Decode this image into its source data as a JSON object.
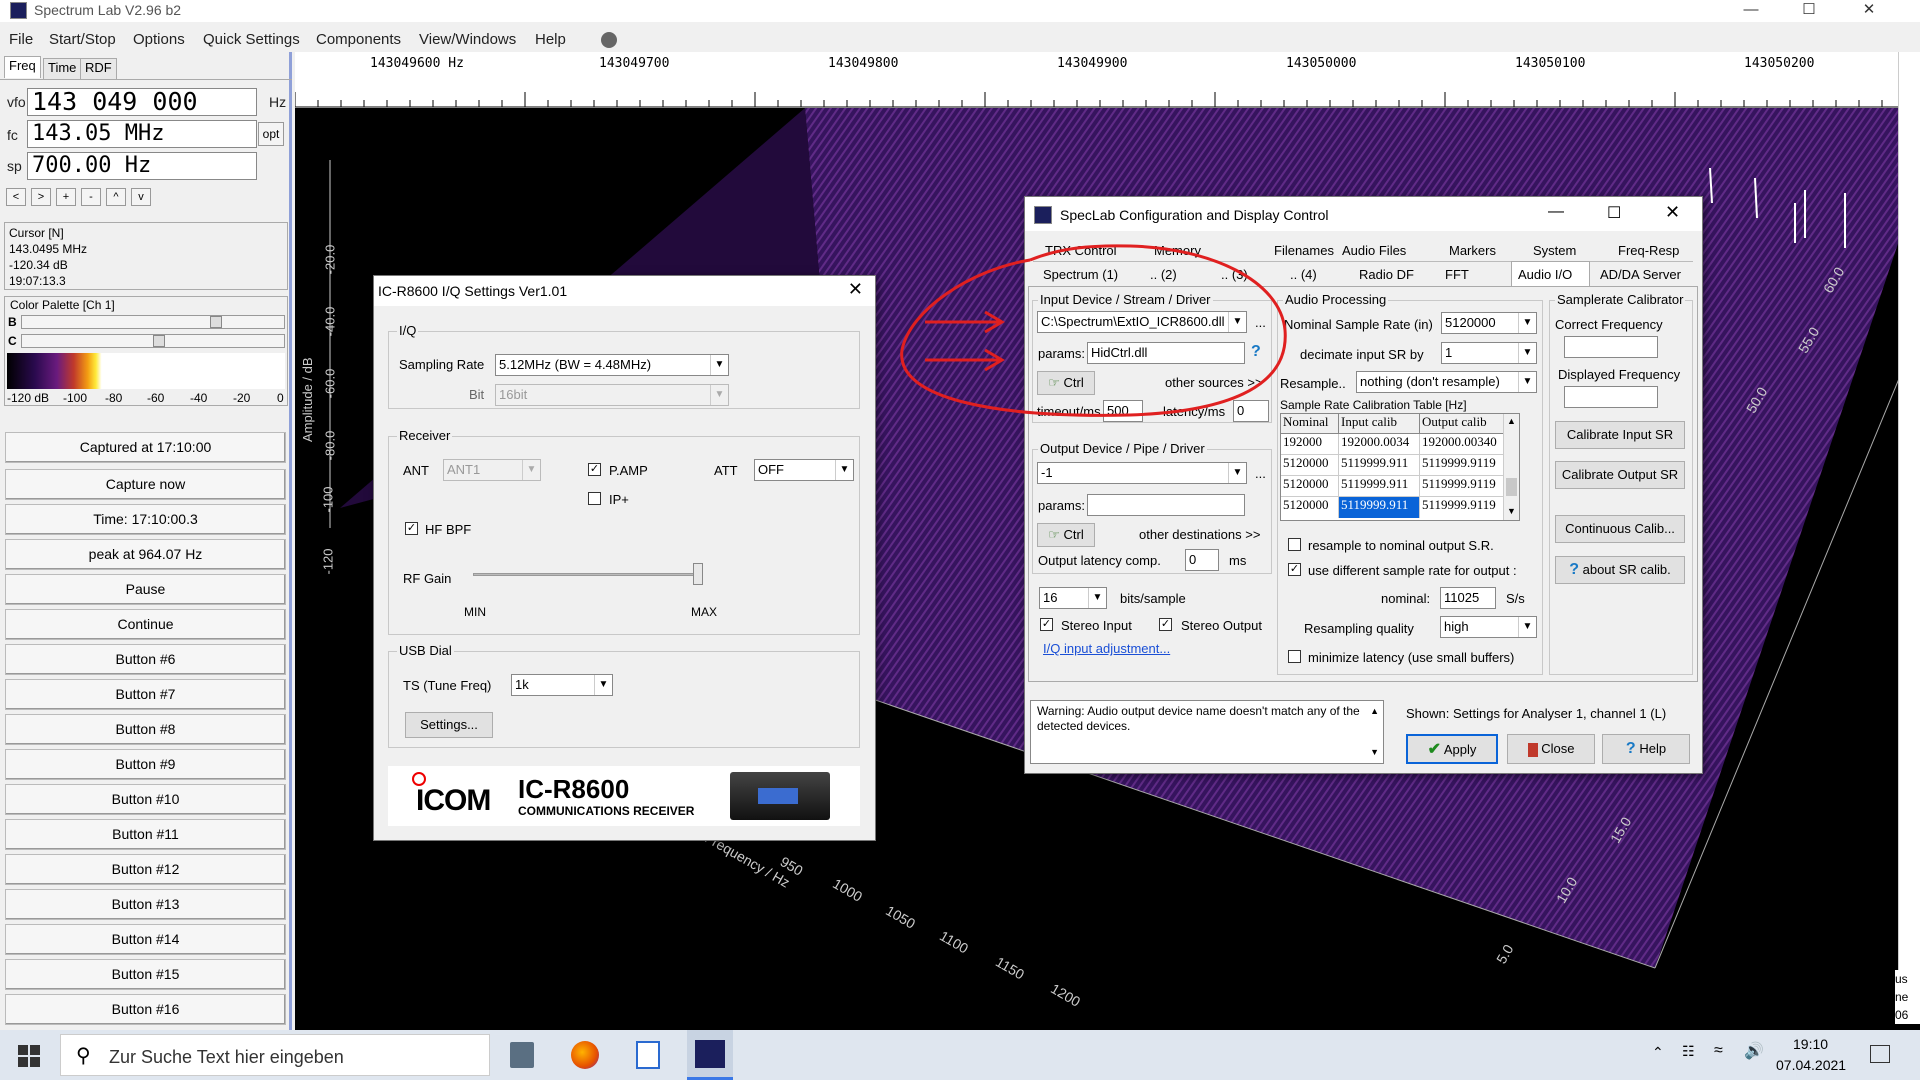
{
  "app": {
    "title": "Spectrum Lab V2.96 b2"
  },
  "menu": [
    "File",
    "Start/Stop",
    "Options",
    "Quick Settings",
    "Components",
    "View/Windows",
    "Help"
  ],
  "left": {
    "tabs": [
      "Freq",
      "Time",
      "RDF"
    ],
    "vfo_label": "vfo",
    "vfo_value": "143 049 000",
    "vfo_unit": "Hz",
    "fc_label": "fc",
    "fc_value": "143.05 MHz",
    "fc_opt": "opt",
    "sp_label": "sp",
    "sp_value": "700.00 Hz",
    "nav_buttons": [
      "<",
      ">",
      "+",
      "-",
      "^",
      "v"
    ],
    "cursor_title": "Cursor [N]",
    "cursor_lines": [
      "143.0495 MHz",
      "-120.34 dB",
      "19:07:13.3"
    ],
    "palette_title": "Color Palette [Ch 1]",
    "palette_b": "B",
    "palette_c": "C",
    "palette_ticks": [
      "-120 dB",
      "-100",
      "-80",
      "-60",
      "-40",
      "-20",
      "0"
    ],
    "buttons": [
      "Captured at 17:10:00",
      "Capture now",
      "Time:  17:10:00.3",
      "peak at 964.07 Hz",
      "Pause",
      "Continue",
      "Button #6",
      "Button #7",
      "Button #8",
      "Button #9",
      "Button #10",
      "Button #11",
      "Button #12",
      "Button #13",
      "Button #14",
      "Button #15",
      "Button #16"
    ]
  },
  "spectrum": {
    "freq_ticks": [
      "143049600 Hz",
      "143049700",
      "143049800",
      "143049900",
      "143050000",
      "143050100",
      "143050200"
    ],
    "amp_label": "Amplitude / dB",
    "amp_ticks": [
      "-20.0",
      "-40.0",
      "-60.0",
      "-80.0",
      "-100",
      "-120"
    ],
    "freq_axis_label": "Frequency / Hz",
    "freq_axis_ticks": [
      "950",
      "1000",
      "1050",
      "1100",
      "1150",
      "1200"
    ],
    "time_ticks": [
      "60.0",
      "55.0",
      "50.0",
      "15.0",
      "10.0",
      "5.0"
    ],
    "edge_text": [
      "us",
      "ne",
      "06"
    ]
  },
  "icr": {
    "title": "IC-R8600 I/Q Settings    Ver1.01",
    "iq_group": "I/Q",
    "sampling_rate_label": "Sampling Rate",
    "sampling_rate_value": "5.12MHz (BW = 4.48MHz)",
    "bit_label": "Bit",
    "bit_value": "16bit",
    "receiver_group": "Receiver",
    "ant_label": "ANT",
    "ant_value": "ANT1",
    "pamp_label": "P.AMP",
    "ipplus_label": "IP+",
    "att_label": "ATT",
    "att_value": "OFF",
    "hfbpf_label": "HF BPF",
    "rfgain_label": "RF Gain",
    "rfgain_min": "MIN",
    "rfgain_max": "MAX",
    "rfgain_level": 1.0,
    "usb_group": "USB Dial",
    "ts_label": "TS (Tune Freq)",
    "ts_value": "1k",
    "settings_button": "Settings...",
    "logo_brand": "ICOM",
    "logo_model": "IC-R8600",
    "logo_sub": "COMMUNICATIONS RECEIVER"
  },
  "speclab": {
    "title": "SpecLab   Configuration and Display Control",
    "tabs_row1": [
      "TRX Control",
      "Memory",
      "Filenames",
      "Audio Files",
      "Markers",
      "System",
      "Freq-Resp"
    ],
    "tabs_row2": [
      "Spectrum (1)",
      ".. (2)",
      ".. (3)",
      ".. (4)",
      "Radio DF",
      "FFT",
      "Audio I/O",
      "AD/DA Server"
    ],
    "input_group": "Input Device / Stream / Driver",
    "input_device": "C:\\Spectrum\\ExtIO_ICR8600.dll",
    "params_label": "params:",
    "params_value": "HidCtrl.dll",
    "ctrl_label": "Ctrl",
    "other_sources": "other sources >>",
    "timeout_label": "timeout/ms",
    "timeout_value": "500",
    "latency_label": "latency/ms",
    "latency_value": "0",
    "output_group": "Output Device / Pipe / Driver",
    "output_device": "-1",
    "out_params_label": "params:",
    "out_params_value": "",
    "out_ctrl_label": "Ctrl",
    "other_destinations": "other destinations >>",
    "out_latency_label": "Output latency comp.",
    "out_latency_value": "0",
    "out_latency_unit": "ms",
    "bits_value": "16",
    "bits_label": "bits/sample",
    "stereo_in": "Stereo Input",
    "stereo_out": "Stereo Output",
    "iq_link": "I/Q input adjustment...",
    "audio_group": "Audio Processing",
    "nominal_sr_label": "Nominal Sample Rate (in)",
    "nominal_sr_value": "5120000",
    "decimate_label": "decimate input SR by",
    "decimate_value": "1",
    "resample_label": "Resample..",
    "resample_value": "nothing (don't resample)",
    "calib_table_label": "Sample Rate Calibration Table [Hz]",
    "calib_headers": [
      "Nominal",
      "Input calib",
      "Output calib"
    ],
    "calib_rows": [
      [
        "192000",
        "192000.0034",
        "192000.00340"
      ],
      [
        "5120000",
        "5119999.911",
        "5119999.9119"
      ],
      [
        "5120000",
        "5119999.911",
        "5119999.9119"
      ],
      [
        "5120000",
        "5119999.911",
        "5119999.9119"
      ]
    ],
    "resample_nominal_label": "resample to nominal output S.R.",
    "diff_rate_label": "use different sample rate for output :",
    "nominal_label": "nominal:",
    "nominal_value": "11025",
    "nominal_unit": "S/s",
    "quality_label": "Resampling quality",
    "quality_value": "high",
    "minlat_label": "minimize latency (use small buffers)",
    "calibrator_group": "Samplerate Calibrator",
    "correct_freq_label": "Correct Frequency",
    "displayed_freq_label": "Displayed Frequency",
    "calib_input_btn": "Calibrate Input SR",
    "calib_output_btn": "Calibrate Output SR",
    "cont_calib_btn": "Continuous Calib...",
    "about_btn": "about SR calib.",
    "warning": "Warning: Audio output device name doesn't match any of the detected devices.",
    "shown": "Shown: Settings for Analyser 1, channel 1 (L)",
    "apply_btn": "Apply",
    "close_btn": "Close",
    "help_btn": "Help"
  },
  "taskbar": {
    "search_placeholder": "Zur Suche Text hier eingeben",
    "time": "19:10",
    "date": "07.04.2021"
  }
}
